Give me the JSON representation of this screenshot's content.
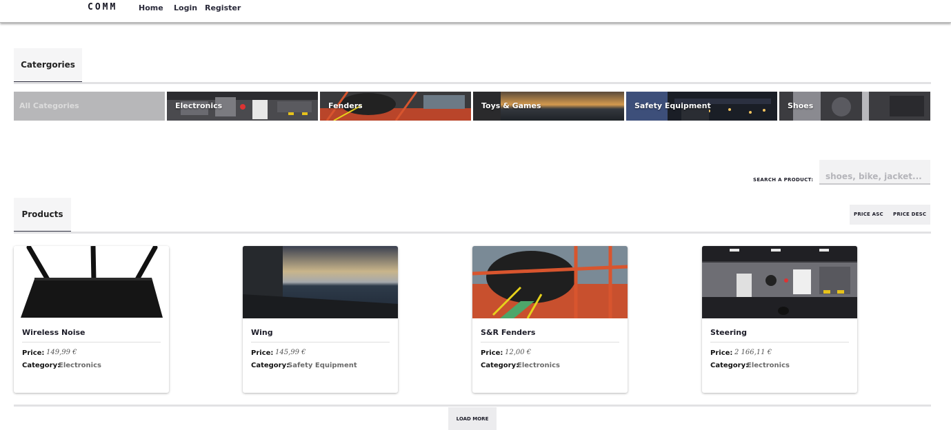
{
  "navbar": {
    "logo": "COMM",
    "links": [
      "Home",
      "Login",
      "Register"
    ]
  },
  "categories_section": {
    "tab_label": "Catergories",
    "items": [
      {
        "label": "All Categories",
        "active": true
      },
      {
        "label": "Electronics",
        "active": false
      },
      {
        "label": "Fenders",
        "active": false
      },
      {
        "label": "Toys & Games",
        "active": false
      },
      {
        "label": "Safety Equipment",
        "active": false
      },
      {
        "label": "Shoes",
        "active": false
      }
    ]
  },
  "search": {
    "label": "SEARCH A PRODUCT:",
    "placeholder": "shoes, bike, jacket..."
  },
  "products_section": {
    "tab_label": "Products",
    "sort_asc": "PRICE ASC",
    "sort_desc": "PRICE DESC",
    "price_label": "Price:",
    "category_label": "Category:",
    "items": [
      {
        "name": "Wireless Noise",
        "price": "149,99 €",
        "category": "Electronics",
        "image": "router-image"
      },
      {
        "name": "Wing",
        "price": "145,99 €",
        "category": "Safety Equipment",
        "image": "ship-wing-image"
      },
      {
        "name": "S&R Fenders",
        "price": "12,00 €",
        "category": "Electronics",
        "image": "fenders-image"
      },
      {
        "name": "Steering",
        "price": "2 166,11 €",
        "category": "Electronics",
        "image": "control-panel-image"
      }
    ],
    "load_more": "LOAD MORE"
  }
}
